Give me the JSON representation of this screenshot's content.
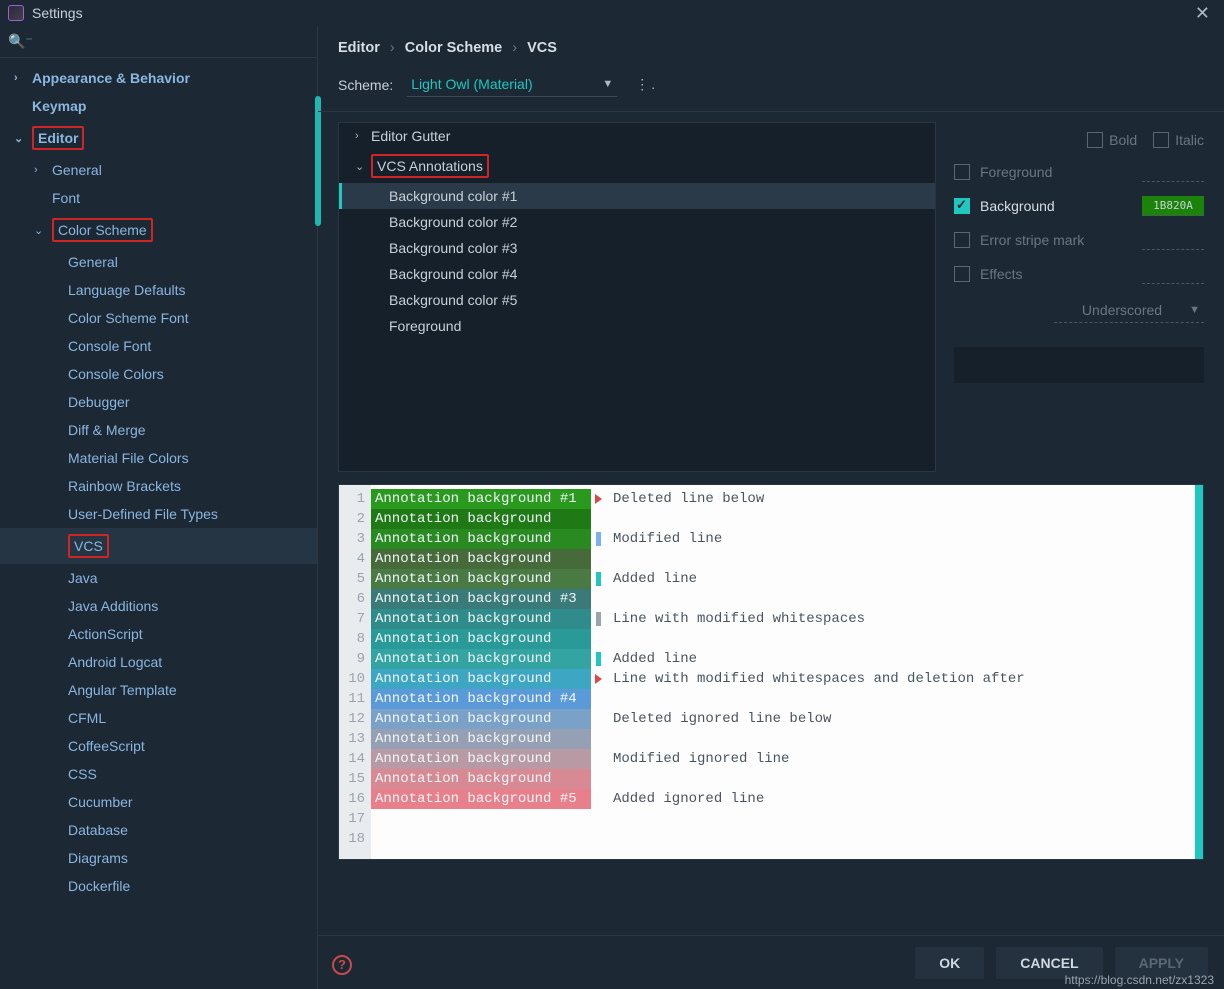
{
  "title": "Settings",
  "breadcrumb": [
    "Editor",
    "Color Scheme",
    "VCS"
  ],
  "scheme": {
    "label": "Scheme:",
    "value": "Light Owl (Material)"
  },
  "sidebar": [
    {
      "label": "Appearance & Behavior",
      "lvl": 0,
      "chev": "›",
      "bold": true
    },
    {
      "label": "Keymap",
      "lvl": 0,
      "bold": true,
      "pad": true
    },
    {
      "label": "Editor",
      "lvl": 0,
      "chev": "⌄",
      "bold": true,
      "boxed": true
    },
    {
      "label": "General",
      "lvl": 1,
      "chev": "›"
    },
    {
      "label": "Font",
      "lvl": 1,
      "pad": true
    },
    {
      "label": "Color Scheme",
      "lvl": 1,
      "chev": "⌄",
      "boxed": true
    },
    {
      "label": "General",
      "lvl": 3
    },
    {
      "label": "Language Defaults",
      "lvl": 3
    },
    {
      "label": "Color Scheme Font",
      "lvl": 3
    },
    {
      "label": "Console Font",
      "lvl": 3
    },
    {
      "label": "Console Colors",
      "lvl": 3
    },
    {
      "label": "Debugger",
      "lvl": 3
    },
    {
      "label": "Diff & Merge",
      "lvl": 3
    },
    {
      "label": "Material File Colors",
      "lvl": 3
    },
    {
      "label": "Rainbow Brackets",
      "lvl": 3
    },
    {
      "label": "User-Defined File Types",
      "lvl": 3
    },
    {
      "label": "VCS",
      "lvl": 3,
      "selected": true,
      "boxed": true
    },
    {
      "label": "Java",
      "lvl": 3
    },
    {
      "label": "Java Additions",
      "lvl": 3
    },
    {
      "label": "ActionScript",
      "lvl": 3
    },
    {
      "label": "Android Logcat",
      "lvl": 3
    },
    {
      "label": "Angular Template",
      "lvl": 3
    },
    {
      "label": "CFML",
      "lvl": 3
    },
    {
      "label": "CoffeeScript",
      "lvl": 3
    },
    {
      "label": "CSS",
      "lvl": 3
    },
    {
      "label": "Cucumber",
      "lvl": 3
    },
    {
      "label": "Database",
      "lvl": 3
    },
    {
      "label": "Diagrams",
      "lvl": 3
    },
    {
      "label": "Dockerfile",
      "lvl": 3
    }
  ],
  "categories": [
    {
      "label": "Editor Gutter",
      "lvl": 1,
      "chev": "›"
    },
    {
      "label": "VCS Annotations",
      "lvl": 1,
      "chev": "⌄",
      "boxed": true
    },
    {
      "label": "Background color #1",
      "lvl": 2,
      "selected": true
    },
    {
      "label": "Background color #2",
      "lvl": 2
    },
    {
      "label": "Background color #3",
      "lvl": 2
    },
    {
      "label": "Background color #4",
      "lvl": 2
    },
    {
      "label": "Background color #5",
      "lvl": 2
    },
    {
      "label": "Foreground",
      "lvl": 2
    }
  ],
  "props": {
    "bold": "Bold",
    "italic": "Italic",
    "foreground": "Foreground",
    "background": "Background",
    "background_hex": "1B820A",
    "error_stripe": "Error stripe mark",
    "effects": "Effects",
    "effect_type": "Underscored"
  },
  "preview": {
    "annotations": [
      {
        "text": "Annotation background #1",
        "bg": "#2a9a1f"
      },
      {
        "text": "Annotation background",
        "bg": "#1f7a16"
      },
      {
        "text": "Annotation background",
        "bg": "#2a8a22"
      },
      {
        "text": "Annotation background",
        "bg": "#466a3a"
      },
      {
        "text": "Annotation background",
        "bg": "#4a7a44"
      },
      {
        "text": "Annotation background #3",
        "bg": "#3a7a78"
      },
      {
        "text": "Annotation background",
        "bg": "#2f8c8a"
      },
      {
        "text": "Annotation background",
        "bg": "#2a9a98"
      },
      {
        "text": "Annotation background",
        "bg": "#34a4a2"
      },
      {
        "text": "Annotation background",
        "bg": "#3da6c2"
      },
      {
        "text": "Annotation background #4",
        "bg": "#5a9ad8"
      },
      {
        "text": "Annotation background",
        "bg": "#7aa2c8"
      },
      {
        "text": "Annotation background",
        "bg": "#96a0b4"
      },
      {
        "text": "Annotation background",
        "bg": "#b89aa4"
      },
      {
        "text": "Annotation background",
        "bg": "#d88a94"
      },
      {
        "text": "Annotation background #5",
        "bg": "#e8808c"
      },
      {
        "text": "",
        "bg": "transparent"
      },
      {
        "text": "",
        "bg": "transparent"
      }
    ],
    "markers": [
      "tri-red",
      "",
      "bar-blue",
      "",
      "bar-teal",
      "",
      "bar-gray",
      "",
      "bar-teal",
      "tri-red",
      "",
      "",
      "",
      "",
      "",
      "",
      "",
      ""
    ],
    "code": [
      "Deleted line below",
      "",
      "Modified line",
      "",
      "Added line",
      "",
      "Line with modified whitespaces",
      "",
      "Added line",
      "Line with modified whitespaces and deletion after",
      "",
      "Deleted ignored line below",
      "",
      "Modified ignored line",
      "",
      "Added ignored line",
      "",
      ""
    ]
  },
  "buttons": {
    "ok": "OK",
    "cancel": "CANCEL",
    "apply": "APPLY"
  },
  "watermark": "https://blog.csdn.net/zx1323"
}
